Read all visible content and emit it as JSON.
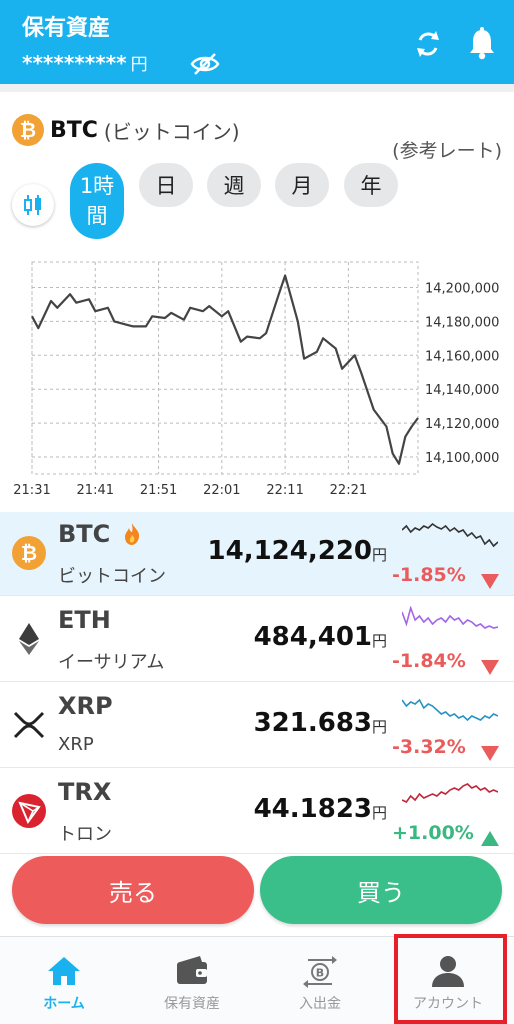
{
  "header": {
    "title": "保有資産",
    "balance_masked": "**********",
    "currency": "円"
  },
  "coin_header": {
    "icon_letter": "₿",
    "symbol": "BTC",
    "name": "(ビットコイン)",
    "reference_rate": "(参考レート)"
  },
  "period_tabs": [
    {
      "label_line1": "1時",
      "label_line2": "間",
      "active": true
    },
    {
      "label": "日"
    },
    {
      "label": "週"
    },
    {
      "label": "月"
    },
    {
      "label": "年"
    }
  ],
  "chart_data": {
    "type": "line",
    "x_ticks": [
      "21:31",
      "21:41",
      "21:51",
      "22:01",
      "22:11",
      "22:21"
    ],
    "y_ticks": [
      "14,200,000",
      "14,180,000",
      "14,160,000",
      "14,140,000",
      "14,120,000",
      "14,100,000"
    ],
    "ylim": [
      14090000,
      14215000
    ],
    "x": [
      "21:31",
      "21:32",
      "21:34",
      "21:35",
      "21:37",
      "21:38",
      "21:40",
      "21:41",
      "21:43",
      "21:44",
      "21:46",
      "21:47",
      "21:49",
      "21:50",
      "21:52",
      "21:53",
      "21:55",
      "21:56",
      "21:58",
      "21:59",
      "22:01",
      "22:02",
      "22:04",
      "22:05",
      "22:07",
      "22:08",
      "22:10",
      "22:11",
      "22:13",
      "22:14",
      "22:16",
      "22:17",
      "22:19",
      "22:20",
      "22:22",
      "22:23",
      "22:25",
      "22:27",
      "22:28",
      "22:29",
      "22:30",
      "22:31",
      "22:32"
    ],
    "values": [
      14183000,
      14176000,
      14192000,
      14188000,
      14196000,
      14191000,
      14193000,
      14186000,
      14188000,
      14180000,
      14178000,
      14177000,
      14177000,
      14183000,
      14182000,
      14185000,
      14181000,
      14188000,
      14186000,
      14189000,
      14183000,
      14186000,
      14168000,
      14171000,
      14170000,
      14173000,
      14196000,
      14207000,
      14180000,
      14158000,
      14162000,
      14170000,
      14164000,
      14152000,
      14160000,
      14150000,
      14128000,
      14118000,
      14102000,
      14096000,
      14112000,
      14118000,
      14123000
    ],
    "grid": true
  },
  "coins": [
    {
      "symbol": "BTC",
      "name": "ビットコイン",
      "price": "14,124,220",
      "yen": "円",
      "change": "-1.85%",
      "direction": "down",
      "hot": true,
      "color": "#333333",
      "spark": [
        44,
        40,
        46,
        42,
        44,
        40,
        42,
        38,
        41,
        43,
        40,
        45,
        42,
        46,
        44,
        50,
        47,
        52,
        50,
        58,
        54,
        60,
        56
      ]
    },
    {
      "symbol": "ETH",
      "name": "イーサリアム",
      "price": "484,401",
      "yen": "円",
      "change": "-1.84%",
      "direction": "down",
      "hot": false,
      "color": "#a366e8",
      "spark": [
        40,
        52,
        36,
        48,
        44,
        50,
        46,
        52,
        48,
        46,
        50,
        44,
        48,
        46,
        52,
        48,
        50,
        54,
        52,
        56,
        54,
        56,
        55
      ]
    },
    {
      "symbol": "XRP",
      "name": "XRP",
      "price": "321.683",
      "yen": "円",
      "change": "-3.32%",
      "direction": "down",
      "hot": false,
      "color": "#2a93c4",
      "spark": [
        42,
        48,
        44,
        46,
        42,
        50,
        46,
        48,
        52,
        56,
        54,
        58,
        56,
        60,
        58,
        62,
        58,
        60,
        62,
        58,
        60,
        56,
        58
      ]
    },
    {
      "symbol": "TRX",
      "name": "トロン",
      "price": "44.1823",
      "yen": "円",
      "change": "+1.00%",
      "direction": "up",
      "hot": false,
      "color": "#c0283a",
      "spark": [
        56,
        58,
        52,
        56,
        50,
        54,
        52,
        50,
        52,
        48,
        50,
        46,
        44,
        46,
        42,
        40,
        44,
        42,
        46,
        44,
        48,
        46,
        48
      ]
    }
  ],
  "actions": {
    "sell": "売る",
    "buy": "買う"
  },
  "bottom_nav": [
    {
      "label": "ホーム",
      "icon": "home-icon",
      "active": true
    },
    {
      "label": "保有資産",
      "icon": "wallet-icon",
      "active": false
    },
    {
      "label": "入出金",
      "icon": "transfer-icon",
      "active": false
    },
    {
      "label": "アカウント",
      "icon": "person-icon",
      "active": false
    }
  ],
  "colors": {
    "brand": "#1ab2ee",
    "sell": "#ed5b5b",
    "buy": "#3bbf8a",
    "down": "#ea5b5b",
    "up": "#3bb882",
    "highlight": "#e8202a"
  }
}
